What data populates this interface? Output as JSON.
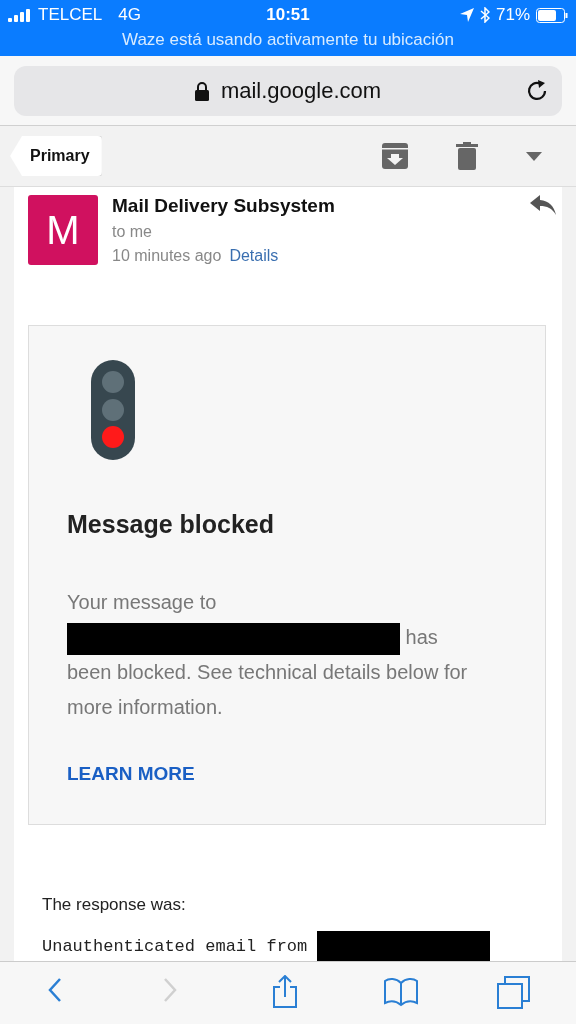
{
  "status_bar": {
    "carrier": "TELCEL",
    "network": "4G",
    "time": "10:51",
    "battery": "71%",
    "banner": "Waze está usando activamente tu ubicación"
  },
  "address_bar": {
    "url": "mail.google.com"
  },
  "mail_toolbar": {
    "back_label": "Primary"
  },
  "message": {
    "avatar_letter": "M",
    "sender": "Mail Delivery Subsystem",
    "recipient": "to me",
    "time": "10 minutes ago",
    "details_link": "Details"
  },
  "notice": {
    "title": "Message blocked",
    "body_start": "Your message to",
    "body_end": "has been blocked. See technical details below for more information.",
    "link": "LEARN MORE"
  },
  "response": {
    "label": "The response was:",
    "code_line": "Unauthenticated email from"
  },
  "bottom_toolbar": [
    {
      "kind": "back",
      "disabled": false
    },
    {
      "kind": "forward",
      "disabled": true
    },
    {
      "kind": "share",
      "disabled": false
    },
    {
      "kind": "bookmarks",
      "disabled": false
    },
    {
      "kind": "tabs",
      "disabled": false
    }
  ]
}
